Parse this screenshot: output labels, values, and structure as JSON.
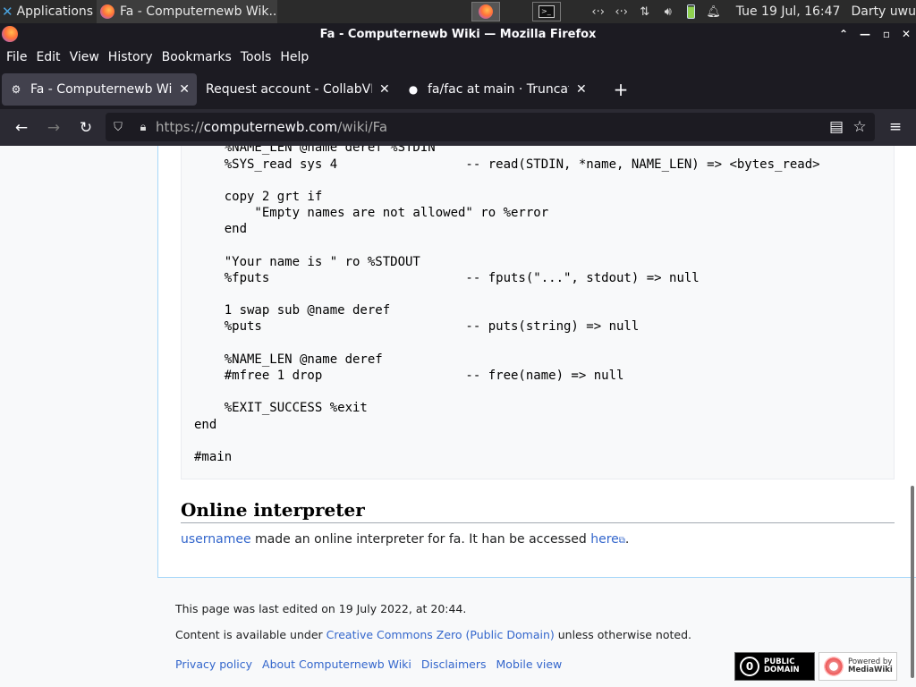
{
  "panel": {
    "apps_label": "Applications",
    "task_label": "Fa - Computernewb Wik...",
    "clock": "Tue 19 Jul, 16:47",
    "user": "Darty uwu"
  },
  "window": {
    "title": "Fa - Computernewb Wiki — Mozilla Firefox"
  },
  "menu": [
    "File",
    "Edit",
    "View",
    "History",
    "Bookmarks",
    "Tools",
    "Help"
  ],
  "tabs": [
    {
      "label": "Fa - Computernewb Wiki",
      "active": true
    },
    {
      "label": "Request account - CollabVM",
      "active": false
    },
    {
      "label": "fa/fac at main · Truncated",
      "active": false
    }
  ],
  "url": {
    "scheme": "https://",
    "host": "computernewb.com",
    "path": "/wiki/Fa"
  },
  "code_lines": [
    "    %NAME_LEN @name deref %STDIN",
    "    %SYS_read sys 4                 -- read(STDIN, *name, NAME_LEN) => <bytes_read>",
    "",
    "    copy 2 grt if",
    "        \"Empty names are not allowed\" ro %error",
    "    end",
    "",
    "    \"Your name is \" ro %STDOUT",
    "    %fputs                          -- fputs(\"...\", stdout) => null",
    "",
    "    1 swap sub @name deref",
    "    %puts                           -- puts(string) => null",
    "",
    "    %NAME_LEN @name deref",
    "    #mfree 1 drop                   -- free(name) => null",
    "",
    "    %EXIT_SUCCESS %exit",
    "end",
    "",
    "#main"
  ],
  "section": {
    "heading": "Online interpreter",
    "user_link": "usernamee",
    "text_mid": " made an online interpreter for fa. It han be accessed ",
    "here_link": "here",
    "text_end": "."
  },
  "footer": {
    "last_edited": "This page was last edited on 19 July 2022, at 20:44.",
    "license_prefix": "Content is available under ",
    "license_link": "Creative Commons Zero (Public Domain)",
    "license_suffix": " unless otherwise noted.",
    "links": [
      "Privacy policy",
      "About Computernewb Wiki",
      "Disclaimers",
      "Mobile view"
    ],
    "badge_pd_line1": "PUBLIC",
    "badge_pd_line2": "DOMAIN",
    "badge_mw_line1": "Powered by",
    "badge_mw_line2": "MediaWiki"
  }
}
